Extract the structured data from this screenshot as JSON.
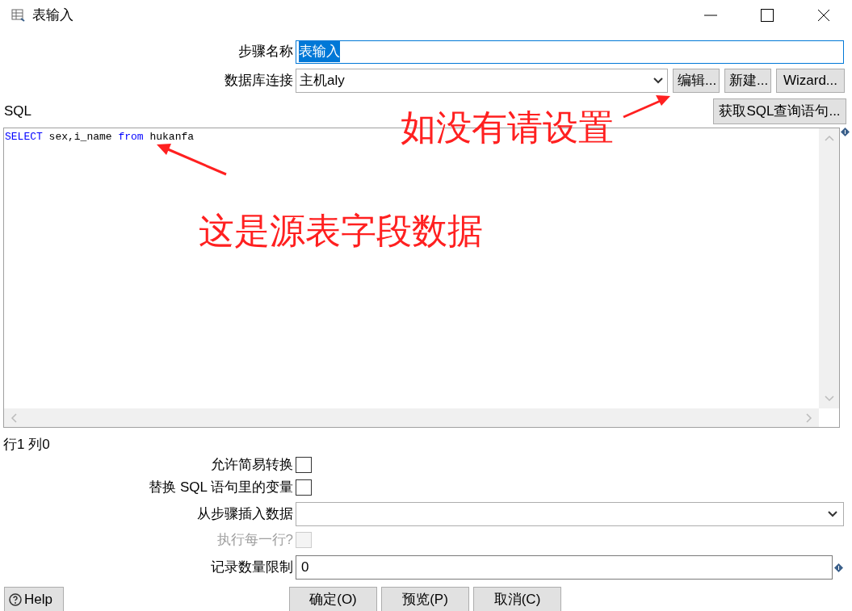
{
  "window": {
    "title": "表输入"
  },
  "step_name": {
    "label": "步骤名称",
    "value": "表输入"
  },
  "connection": {
    "label": "数据库连接",
    "value": "主机aly",
    "buttons": [
      "编辑...",
      "新建...",
      "Wizard..."
    ]
  },
  "sql": {
    "label": "SQL",
    "get_button": "获取SQL查询语句...",
    "tokens": [
      {
        "text": "SELECT",
        "kind": "keyword"
      },
      {
        "text": " sex,i_name ",
        "kind": "plain"
      },
      {
        "text": "from",
        "kind": "keyword"
      },
      {
        "text": " hukanfa",
        "kind": "plain"
      }
    ]
  },
  "cursor_position": "行1 列0",
  "options": [
    {
      "label": "允许简易转换",
      "checked": false,
      "disabled": false
    },
    {
      "label": "替换 SQL 语句里的变量",
      "checked": false,
      "disabled": false
    }
  ],
  "insert_from_step": {
    "label": "从步骤插入数据"
  },
  "execute_each_row": {
    "label": "执行每一行?",
    "checked": false,
    "disabled": true
  },
  "limit": {
    "label": "记录数量限制",
    "value": "0"
  },
  "help_button": "Help",
  "buttons": [
    "确定(O)",
    "预览(P)",
    "取消(C)"
  ],
  "annotations": [
    "如没有请设置",
    "这是源表字段数据"
  ]
}
